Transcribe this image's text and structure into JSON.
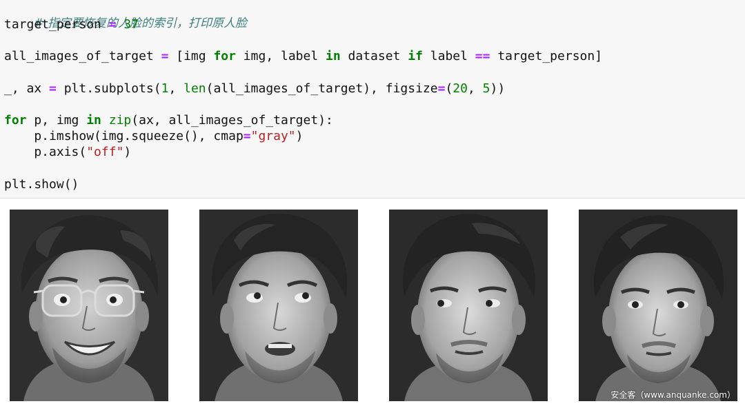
{
  "code": {
    "comment": "# 指定要恢复的人脸的索引，打印原人脸",
    "line1": {
      "var": "target_person ",
      "eq": "=",
      "val": " 37"
    },
    "line2": {
      "a": "all_images_of_target ",
      "eq": "=",
      "b": " [img ",
      "for": "for",
      "c": " img, label ",
      "in": "in",
      "d": " dataset ",
      "if": "if",
      "e": " label ",
      "op": "==",
      "f": " target_person]"
    },
    "line3": {
      "a": "_, ax ",
      "eq": "=",
      "b": " plt.subplots(",
      "n1": "1",
      "c": ", ",
      "len": "len",
      "d": "(all_images_of_target), figsize",
      "eq2": "=",
      "e": "(",
      "n2": "20",
      "f": ", ",
      "n3": "5",
      "g": "))"
    },
    "line4": {
      "for": "for",
      "a": " p, img ",
      "in": "in",
      "b": " ",
      "zip": "zip",
      "c": "(ax, all_images_of_target):"
    },
    "line5": {
      "a": "    p.imshow(img.squeeze(), cmap",
      "eq": "=",
      "s": "\"gray\"",
      "b": ")"
    },
    "line6": {
      "a": "    p.axis(",
      "s": "\"off\"",
      "b": ")"
    },
    "line7": "plt.show()"
  },
  "output": {
    "images": [
      {
        "description": "face-with-glasses"
      },
      {
        "description": "face-looking-up"
      },
      {
        "description": "face-looking-left"
      },
      {
        "description": "face-neutral"
      }
    ]
  },
  "watermark": "安全客（www.anquanke.com）",
  "colors": {
    "keyword": "#008000",
    "operator": "#aa22ff",
    "string": "#ba2121",
    "comment": "#408080",
    "cell_background": "#f7f7f7"
  }
}
